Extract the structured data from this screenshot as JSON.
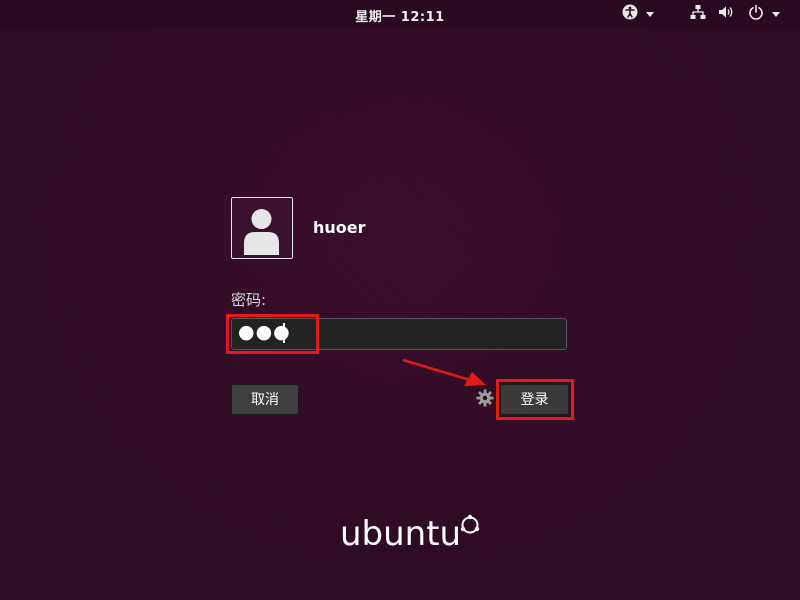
{
  "topbar": {
    "clock": "星期一 12:11",
    "icons": [
      "accessibility-icon",
      "network-icon",
      "volume-icon",
      "power-icon"
    ]
  },
  "login": {
    "username": "huoer",
    "password_label": "密码:",
    "password_value": "●●●",
    "cancel_label": "取消",
    "login_label": "登录"
  },
  "brand": {
    "logo_text": "ubuntu"
  },
  "colors": {
    "background": "#2c0a22",
    "highlight": "#e11a1a"
  }
}
